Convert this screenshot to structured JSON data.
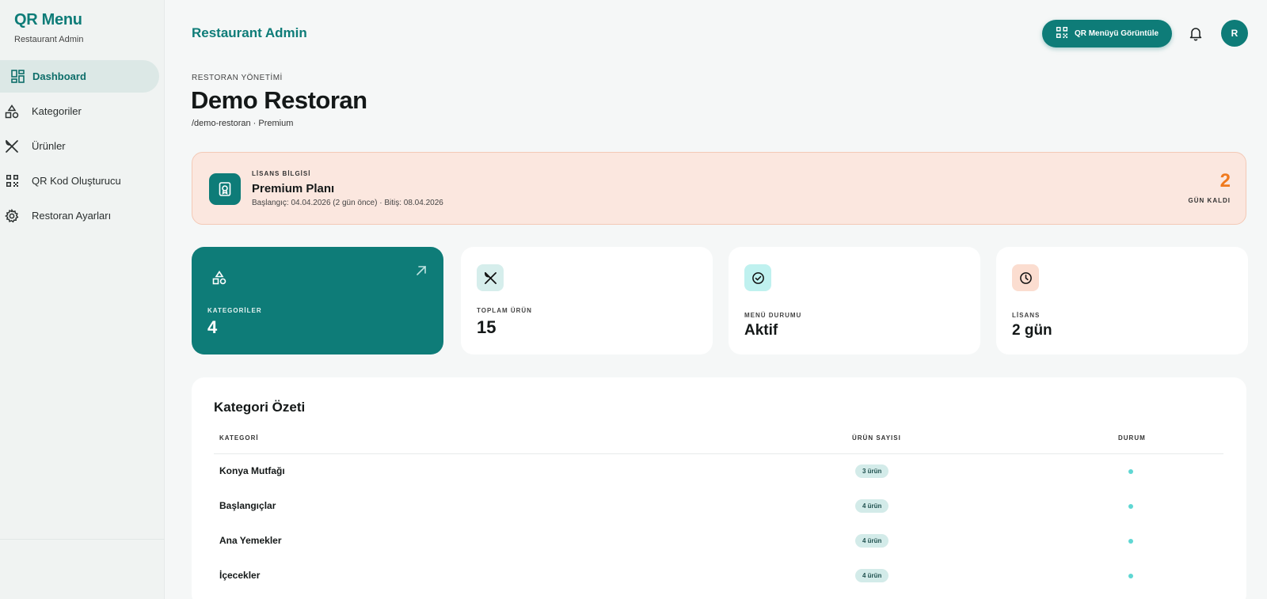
{
  "sidebar": {
    "brand_title": "QR Menu",
    "brand_subtitle": "Restaurant Admin",
    "items": [
      {
        "label": "Dashboard",
        "icon": "dashboard-icon",
        "active": true
      },
      {
        "label": "Kategoriler",
        "icon": "categories-icon",
        "active": false
      },
      {
        "label": "Ürünler",
        "icon": "utensils-icon",
        "active": false
      },
      {
        "label": "QR Kod Oluşturucu",
        "icon": "qr-code-icon",
        "active": false
      },
      {
        "label": "Restoran Ayarları",
        "icon": "gear-icon",
        "active": false
      }
    ]
  },
  "header": {
    "title": "Restaurant Admin",
    "qr_button_label": "QR Menüyü Görüntüle",
    "avatar_initial": "R"
  },
  "page": {
    "eyebrow": "RESTORAN YÖNETİMİ",
    "title": "Demo Restoran",
    "meta": "/demo-restoran · Premium"
  },
  "license": {
    "label": "LİSANS BİLGİSİ",
    "plan": "Premium Planı",
    "dates": "Başlangıç: 04.04.2026 (2 gün önce) · Bitiş: 08.04.2026",
    "days_left": "2",
    "days_left_label": "GÜN KALDI"
  },
  "stats": [
    {
      "label": "KATEGORİLER",
      "value": "4",
      "icon": "categories-icon"
    },
    {
      "label": "TOPLAM ÜRÜN",
      "value": "15",
      "icon": "utensils-icon"
    },
    {
      "label": "MENÜ DURUMU",
      "value": "Aktif",
      "icon": "check-circle-icon"
    },
    {
      "label": "LİSANS",
      "value": "2 gün",
      "icon": "clock-icon"
    }
  ],
  "category_summary": {
    "title": "Kategori Özeti",
    "columns": [
      "KATEGORİ",
      "ÜRÜN SAYISI",
      "DURUM"
    ],
    "rows": [
      {
        "name": "Konya Mutfağı",
        "count": "3 ürün",
        "status": "active"
      },
      {
        "name": "Başlangıçlar",
        "count": "4 ürün",
        "status": "active"
      },
      {
        "name": "Ana Yemekler",
        "count": "4 ürün",
        "status": "active"
      },
      {
        "name": "İçecekler",
        "count": "4 ürün",
        "status": "active"
      }
    ]
  },
  "colors": {
    "primary": "#0e7c78",
    "license_bg": "#fbe7df",
    "accent_orange": "#f07a1e",
    "status_dot": "#5fd7d3"
  }
}
